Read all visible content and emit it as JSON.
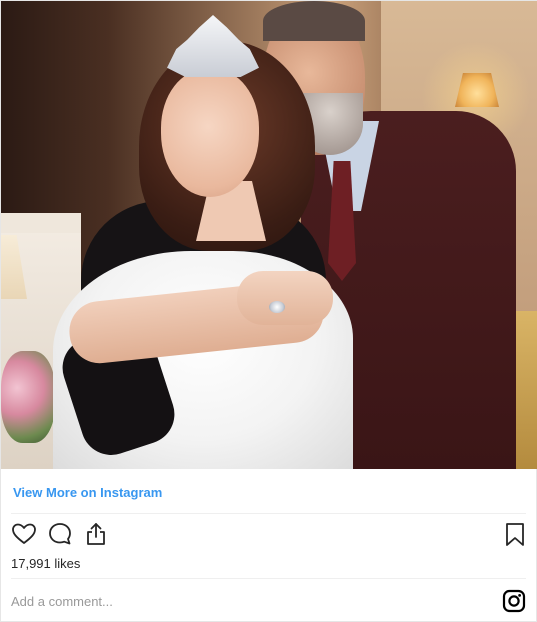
{
  "photo": {
    "icon": "photo"
  },
  "footer": {
    "view_more_label": "View More on Instagram",
    "likes_text": "17,991 likes",
    "comment_placeholder": "Add a comment...",
    "icons": {
      "like": "heart-icon",
      "comment": "speech-bubble-icon",
      "share": "share-icon",
      "save": "bookmark-icon",
      "instagram": "instagram-logo-icon"
    }
  },
  "colors": {
    "link": "#3897f0",
    "text": "#262626",
    "placeholder": "#999999",
    "divider": "#efefef"
  }
}
